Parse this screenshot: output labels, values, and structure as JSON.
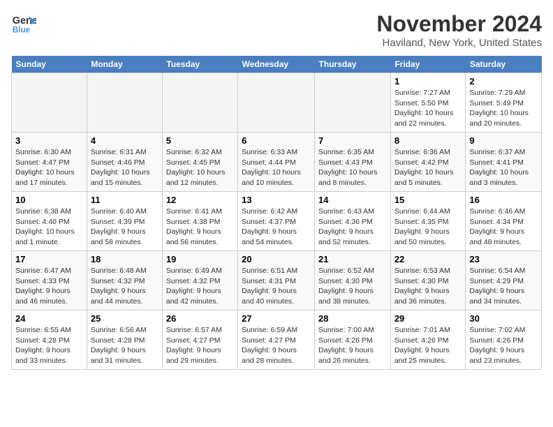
{
  "logo": {
    "line1": "General",
    "line2": "Blue"
  },
  "title": "November 2024",
  "location": "Haviland, New York, United States",
  "weekdays": [
    "Sunday",
    "Monday",
    "Tuesday",
    "Wednesday",
    "Thursday",
    "Friday",
    "Saturday"
  ],
  "weeks": [
    [
      {
        "day": "",
        "info": ""
      },
      {
        "day": "",
        "info": ""
      },
      {
        "day": "",
        "info": ""
      },
      {
        "day": "",
        "info": ""
      },
      {
        "day": "",
        "info": ""
      },
      {
        "day": "1",
        "info": "Sunrise: 7:27 AM\nSunset: 5:50 PM\nDaylight: 10 hours and 22 minutes."
      },
      {
        "day": "2",
        "info": "Sunrise: 7:29 AM\nSunset: 5:49 PM\nDaylight: 10 hours and 20 minutes."
      }
    ],
    [
      {
        "day": "3",
        "info": "Sunrise: 6:30 AM\nSunset: 4:47 PM\nDaylight: 10 hours and 17 minutes."
      },
      {
        "day": "4",
        "info": "Sunrise: 6:31 AM\nSunset: 4:46 PM\nDaylight: 10 hours and 15 minutes."
      },
      {
        "day": "5",
        "info": "Sunrise: 6:32 AM\nSunset: 4:45 PM\nDaylight: 10 hours and 12 minutes."
      },
      {
        "day": "6",
        "info": "Sunrise: 6:33 AM\nSunset: 4:44 PM\nDaylight: 10 hours and 10 minutes."
      },
      {
        "day": "7",
        "info": "Sunrise: 6:35 AM\nSunset: 4:43 PM\nDaylight: 10 hours and 8 minutes."
      },
      {
        "day": "8",
        "info": "Sunrise: 6:36 AM\nSunset: 4:42 PM\nDaylight: 10 hours and 5 minutes."
      },
      {
        "day": "9",
        "info": "Sunrise: 6:37 AM\nSunset: 4:41 PM\nDaylight: 10 hours and 3 minutes."
      }
    ],
    [
      {
        "day": "10",
        "info": "Sunrise: 6:38 AM\nSunset: 4:40 PM\nDaylight: 10 hours and 1 minute."
      },
      {
        "day": "11",
        "info": "Sunrise: 6:40 AM\nSunset: 4:39 PM\nDaylight: 9 hours and 58 minutes."
      },
      {
        "day": "12",
        "info": "Sunrise: 6:41 AM\nSunset: 4:38 PM\nDaylight: 9 hours and 56 minutes."
      },
      {
        "day": "13",
        "info": "Sunrise: 6:42 AM\nSunset: 4:37 PM\nDaylight: 9 hours and 54 minutes."
      },
      {
        "day": "14",
        "info": "Sunrise: 6:43 AM\nSunset: 4:36 PM\nDaylight: 9 hours and 52 minutes."
      },
      {
        "day": "15",
        "info": "Sunrise: 6:44 AM\nSunset: 4:35 PM\nDaylight: 9 hours and 50 minutes."
      },
      {
        "day": "16",
        "info": "Sunrise: 6:46 AM\nSunset: 4:34 PM\nDaylight: 9 hours and 48 minutes."
      }
    ],
    [
      {
        "day": "17",
        "info": "Sunrise: 6:47 AM\nSunset: 4:33 PM\nDaylight: 9 hours and 46 minutes."
      },
      {
        "day": "18",
        "info": "Sunrise: 6:48 AM\nSunset: 4:32 PM\nDaylight: 9 hours and 44 minutes."
      },
      {
        "day": "19",
        "info": "Sunrise: 6:49 AM\nSunset: 4:32 PM\nDaylight: 9 hours and 42 minutes."
      },
      {
        "day": "20",
        "info": "Sunrise: 6:51 AM\nSunset: 4:31 PM\nDaylight: 9 hours and 40 minutes."
      },
      {
        "day": "21",
        "info": "Sunrise: 6:52 AM\nSunset: 4:30 PM\nDaylight: 9 hours and 38 minutes."
      },
      {
        "day": "22",
        "info": "Sunrise: 6:53 AM\nSunset: 4:30 PM\nDaylight: 9 hours and 36 minutes."
      },
      {
        "day": "23",
        "info": "Sunrise: 6:54 AM\nSunset: 4:29 PM\nDaylight: 9 hours and 34 minutes."
      }
    ],
    [
      {
        "day": "24",
        "info": "Sunrise: 6:55 AM\nSunset: 4:28 PM\nDaylight: 9 hours and 33 minutes."
      },
      {
        "day": "25",
        "info": "Sunrise: 6:56 AM\nSunset: 4:28 PM\nDaylight: 9 hours and 31 minutes."
      },
      {
        "day": "26",
        "info": "Sunrise: 6:57 AM\nSunset: 4:27 PM\nDaylight: 9 hours and 29 minutes."
      },
      {
        "day": "27",
        "info": "Sunrise: 6:59 AM\nSunset: 4:27 PM\nDaylight: 9 hours and 28 minutes."
      },
      {
        "day": "28",
        "info": "Sunrise: 7:00 AM\nSunset: 4:26 PM\nDaylight: 9 hours and 26 minutes."
      },
      {
        "day": "29",
        "info": "Sunrise: 7:01 AM\nSunset: 4:26 PM\nDaylight: 9 hours and 25 minutes."
      },
      {
        "day": "30",
        "info": "Sunrise: 7:02 AM\nSunset: 4:26 PM\nDaylight: 9 hours and 23 minutes."
      }
    ]
  ]
}
